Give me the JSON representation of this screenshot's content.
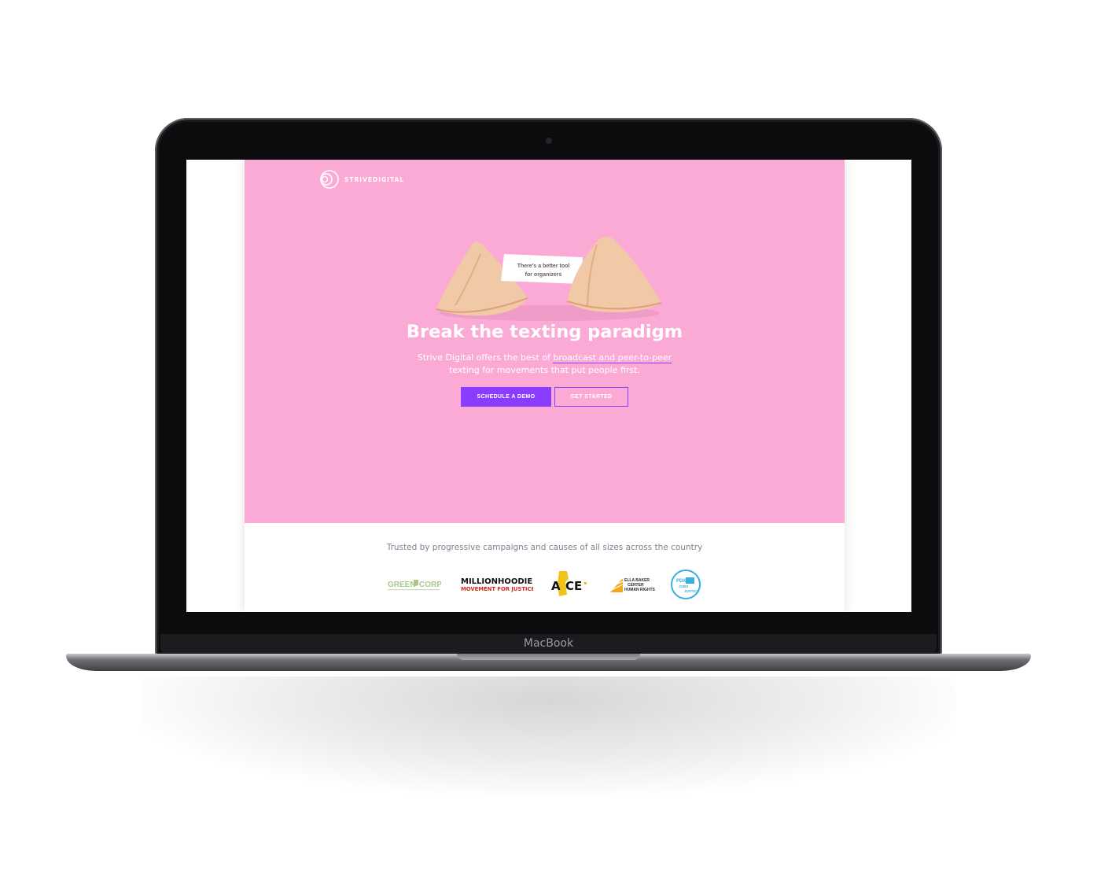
{
  "device": {
    "brand": "MacBook"
  },
  "header": {
    "logo_text": "STRIVEDIGITAL"
  },
  "hero": {
    "fortune_line1": "There's a better tool",
    "fortune_line2": "for organizers",
    "headline": "Break the texting paradigm",
    "sub_before": "Strive Digital offers the best of ",
    "sub_link": "broadcast and peer-to-peer",
    "sub_after": " texting for movements that put people first.",
    "cta_primary": "SCHEDULE A DEMO",
    "cta_secondary": "GET STARTED"
  },
  "clients": {
    "heading": "Trusted by progressive campaigns and causes of all sizes across the country",
    "logos": [
      {
        "lines": [
          "GREEN",
          "CORPS"
        ],
        "icon": "green-corps-logo"
      },
      {
        "lines": [
          "MILLIONHOODIES",
          "MOVEMENT FOR JUSTICE"
        ],
        "icon": "millionhoodies-logo"
      },
      {
        "lines": [
          "A",
          "CE"
        ],
        "icon": "ace-logo"
      },
      {
        "lines": [
          "ELLA BAKER",
          "CENTER",
          "HUMAN RIGHTS"
        ],
        "icon": "ella-baker-center-logo"
      },
      {
        "lines": [
          "PDX",
          "JOBS",
          "JUSTICE"
        ],
        "icon": "pdx-jobs-justice-logo"
      }
    ]
  },
  "colors": {
    "hero_bg": "#fba9d5",
    "accent": "#8a3cff",
    "laptop_bezel": "#0c0c0e"
  }
}
